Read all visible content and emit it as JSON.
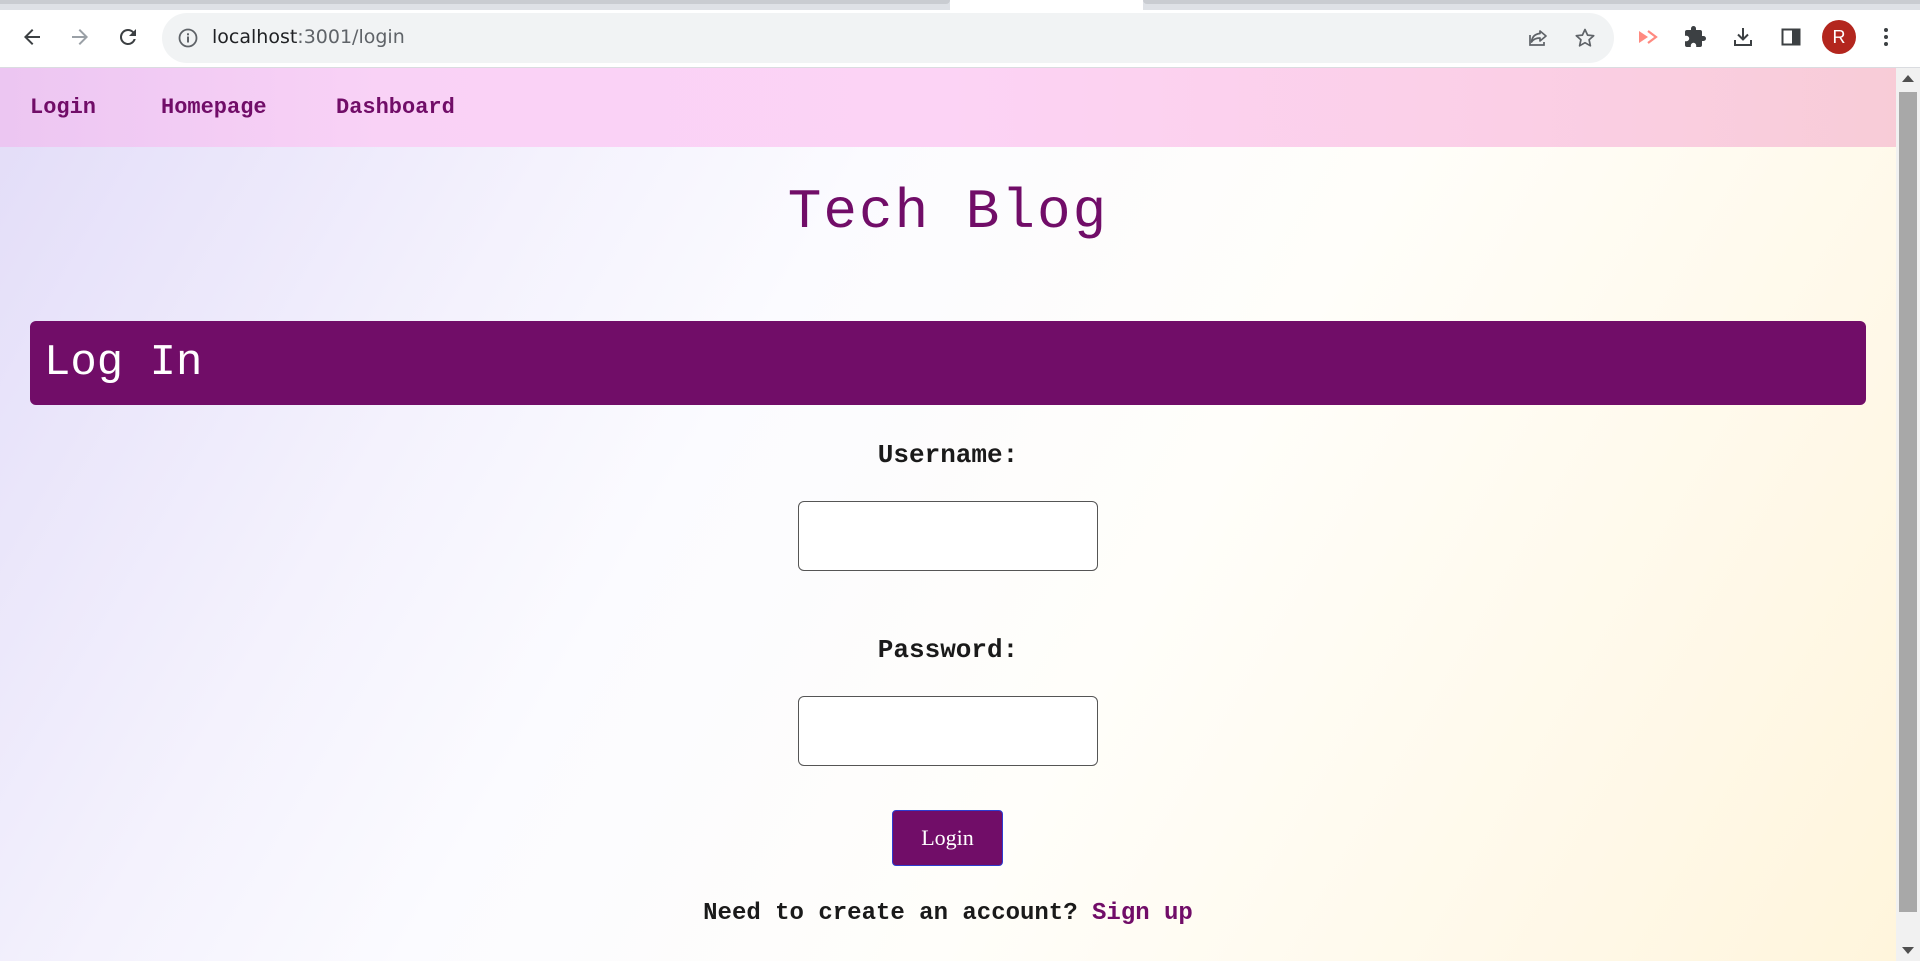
{
  "browser": {
    "url_host": "localhost",
    "url_path": ":3001/login",
    "profile_initial": "R"
  },
  "nav": {
    "links": [
      "Login",
      "Homepage",
      "Dashboard"
    ]
  },
  "header": {
    "title": "Tech Blog"
  },
  "login": {
    "heading": "Log In",
    "username_label": "Username:",
    "username_value": "",
    "password_label": "Password:",
    "password_value": "",
    "submit_label": "Login",
    "signup_prompt": "Need to create an account?",
    "signup_link": "Sign up"
  },
  "colors": {
    "brand": "#710d68",
    "nav_background": "#fcd3f5",
    "avatar": "#b3261e"
  },
  "icons": {
    "back": "arrow-left-icon",
    "forward": "arrow-right-icon",
    "reload": "reload-icon",
    "site_info": "info-icon",
    "share": "share-icon",
    "bookmark": "star-icon",
    "extension_red": "cast-icon",
    "extensions": "puzzle-icon",
    "downloads": "download-icon",
    "side_panel": "side-panel-icon",
    "menu": "kebab-menu-icon"
  }
}
